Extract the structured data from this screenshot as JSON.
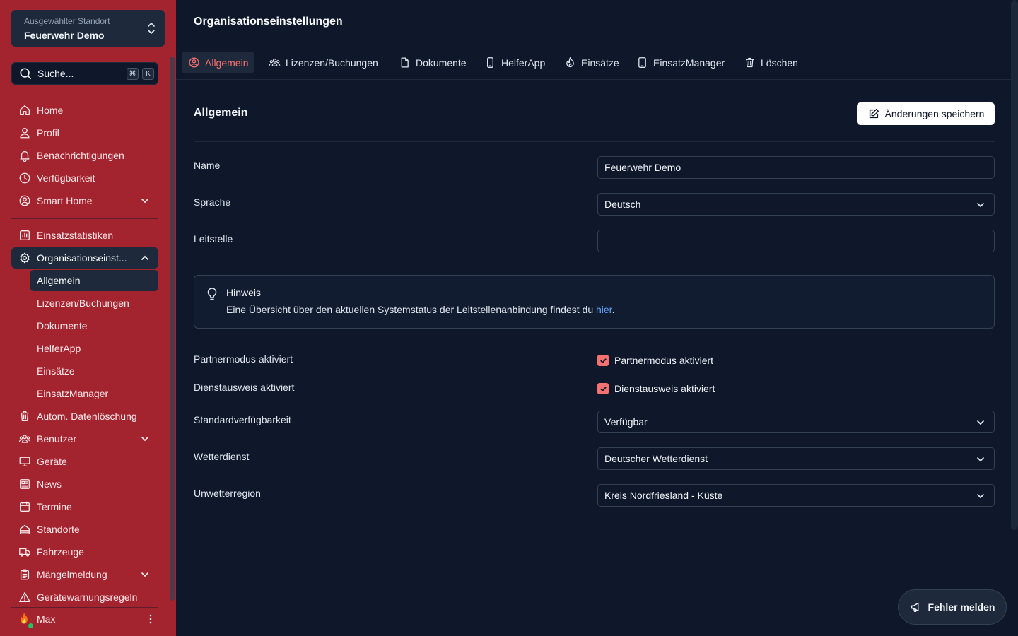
{
  "location": {
    "label": "Ausgewählter Standort",
    "value": "Feuerwehr Demo"
  },
  "search": {
    "placeholder": "Suche...",
    "kbd1": "⌘",
    "kbd2": "K"
  },
  "nav": {
    "home": "Home",
    "profile": "Profil",
    "notifications": "Benachrichtigungen",
    "availability": "Verfügbarkeit",
    "smarthome": "Smart Home",
    "stats": "Einsatzstatistiken",
    "orgsettings": "Organisationseinst...",
    "sub": {
      "general": "Allgemein",
      "licenses": "Lizenzen/Buchungen",
      "documents": "Dokumente",
      "helperapp": "HelferApp",
      "missions": "Einsätze",
      "manager": "EinsatzManager"
    },
    "autodelete": "Autom. Datenlöschung",
    "users": "Benutzer",
    "devices": "Geräte",
    "news": "News",
    "dates": "Termine",
    "locations": "Standorte",
    "vehicles": "Fahrzeuge",
    "defects": "Mängelmeldung",
    "warnrules": "Gerätewarnungsregeln"
  },
  "user": {
    "name": "Max"
  },
  "page": {
    "title": "Organisationseinstellungen"
  },
  "tabs": {
    "general": "Allgemein",
    "licenses": "Lizenzen/Buchungen",
    "documents": "Dokumente",
    "helperapp": "HelferApp",
    "missions": "Einsätze",
    "manager": "EinsatzManager",
    "delete": "Löschen"
  },
  "section": {
    "title": "Allgemein",
    "save_label": "Änderungen speichern"
  },
  "form": {
    "name_label": "Name",
    "name_value": "Feuerwehr Demo",
    "language_label": "Sprache",
    "language_value": "Deutsch",
    "dispatch_label": "Leitstelle",
    "dispatch_value": "",
    "partner_label": "Partnermodus aktiviert",
    "partner_check": "Partnermodus aktiviert",
    "idcard_label": "Dienstausweis aktiviert",
    "idcard_check": "Dienstausweis aktiviert",
    "defaultavail_label": "Standardverfügbarkeit",
    "defaultavail_value": "Verfügbar",
    "weather_label": "Wetterdienst",
    "weather_value": "Deutscher Wetterdienst",
    "region_label": "Unwetterregion",
    "region_value": "Kreis Nordfriesland - Küste"
  },
  "notice": {
    "title": "Hinweis",
    "text": "Eine Übersicht über den aktuellen Systemstatus der Leitstellenanbindung findest du ",
    "link": "hier",
    "end": "."
  },
  "report": {
    "label": "Fehler melden"
  },
  "colors": {
    "sidebar": "#a3232f",
    "accent": "#f87171",
    "background": "#0f172a",
    "link": "#60a5fa"
  }
}
